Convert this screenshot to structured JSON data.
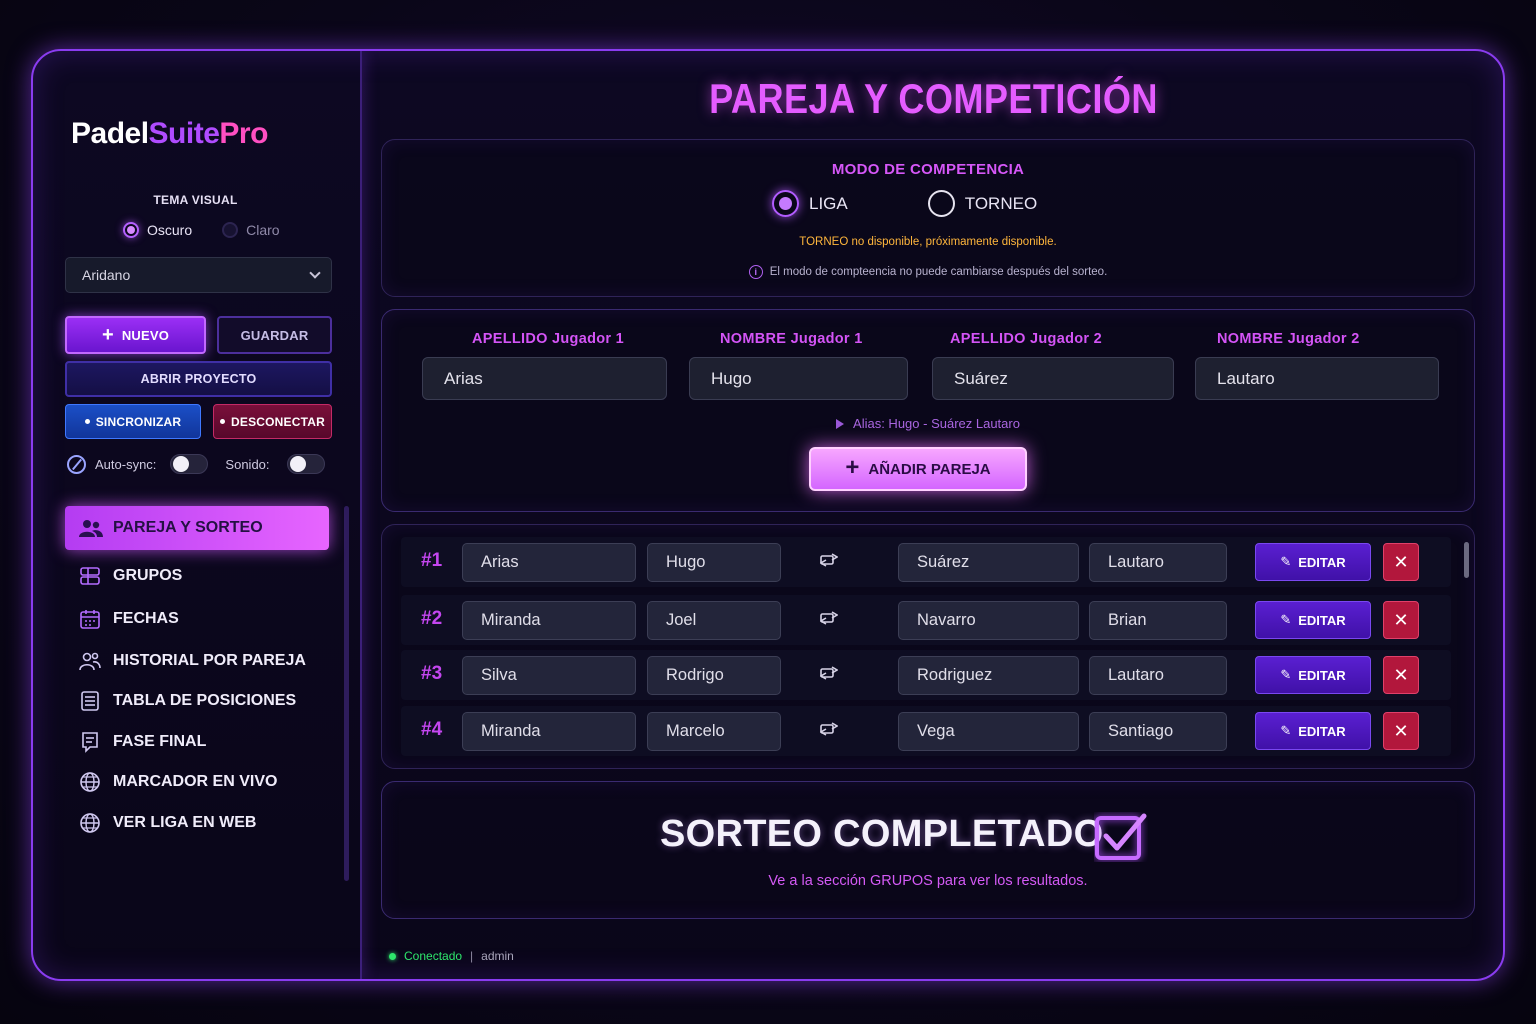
{
  "app": {
    "logo": {
      "part1": "Padel",
      "part2": "Suite",
      "part3": "Pro"
    },
    "accent_color": "#e45cff",
    "background_color": "#0a0619"
  },
  "sidebar": {
    "theme_label": "TEMA VISUAL",
    "theme_options": [
      {
        "label": "Oscuro",
        "selected": true
      },
      {
        "label": "Claro",
        "selected": false
      }
    ],
    "project_select": {
      "value": "Aridano"
    },
    "buttons": {
      "nuevo": "NUEVO",
      "guardar": "GUARDAR",
      "abrir": "ABRIR PROYECTO",
      "sincronizar": "SINCRONIZAR",
      "desconectar": "DESCONECTAR"
    },
    "autosync_label": "Auto-sync:",
    "autosync_on": false,
    "sonido_label": "Sonido:",
    "sonido_on": false,
    "nav": [
      {
        "label": "PAREJA Y SORTEO",
        "icon": "users-icon",
        "active": true
      },
      {
        "label": "GRUPOS",
        "icon": "groups-icon",
        "active": false
      },
      {
        "label": "FECHAS",
        "icon": "calendar-icon",
        "active": false
      },
      {
        "label": "HISTORIAL POR PAREJA",
        "icon": "user-history-icon",
        "active": false
      },
      {
        "label": "TABLA DE POSICIONES",
        "icon": "table-icon",
        "active": false
      },
      {
        "label": "FASE FINAL",
        "icon": "bracket-icon",
        "active": false
      },
      {
        "label": "MARCADOR EN VIVO",
        "icon": "live-globe-icon",
        "active": false
      },
      {
        "label": "VER LIGA EN WEB",
        "icon": "globe-icon",
        "active": false
      }
    ]
  },
  "main": {
    "title": "PAREJA Y COMPETICIÓN",
    "mode": {
      "title": "MODO DE COMPETENCIA",
      "options": [
        {
          "label": "LIGA",
          "selected": true
        },
        {
          "label": "TORNEO",
          "selected": false
        }
      ],
      "warning": "TORNEO no disponible, próximamente disponible.",
      "note": "El modo de compteencia no puede cambiarse después del sorteo."
    },
    "form": {
      "labels": [
        "APELLIDO  Jugador 1",
        "NOMBRE  Jugador 1",
        "APELLIDO  Jugador 2",
        "NOMBRE  Jugador 2"
      ],
      "values": [
        "Arias",
        "Hugo",
        "Suárez",
        "Lautaro"
      ],
      "alias": "Alias: Hugo - Suárez Lautaro",
      "add_button": "AÑADIR PAREJA"
    },
    "pairs": [
      {
        "num": "#1",
        "apellido1": "Arias",
        "nombre1": "Hugo",
        "apellido2": "Suárez",
        "nombre2": "Lautaro"
      },
      {
        "num": "#2",
        "apellido1": "Miranda",
        "nombre1": "Joel",
        "apellido2": "Navarro",
        "nombre2": "Brian"
      },
      {
        "num": "#3",
        "apellido1": "Silva",
        "nombre1": "Rodrigo",
        "apellido2": "Rodriguez",
        "nombre2": "Lautaro"
      },
      {
        "num": "#4",
        "apellido1": "Miranda",
        "nombre1": "Marcelo",
        "apellido2": "Vega",
        "nombre2": "Santiago"
      }
    ],
    "edit_label": "EDITAR",
    "sorteo": {
      "title": "SORTEO COMPLETADO",
      "subtitle": "Ve a la sección GRUPOS para ver los resultados."
    },
    "status": {
      "connection": "Conectado",
      "separator": "|",
      "user": "admin"
    }
  }
}
